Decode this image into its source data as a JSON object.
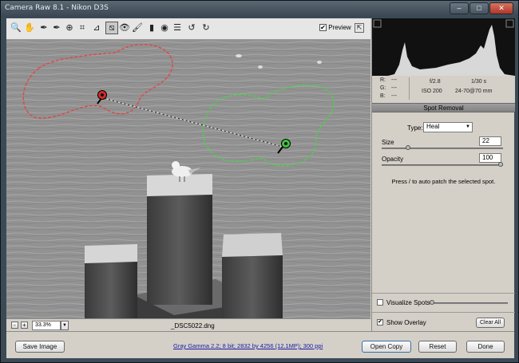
{
  "window": {
    "title": "Camera Raw 8.1  -  Nikon D3S"
  },
  "toolbar": {
    "tools": [
      {
        "name": "zoom-tool",
        "glyph": "🔍"
      },
      {
        "name": "hand-tool",
        "glyph": "✋"
      },
      {
        "name": "white-balance-tool",
        "glyph": "✒"
      },
      {
        "name": "color-sampler-tool",
        "glyph": "✒"
      },
      {
        "name": "targeted-adjustment-tool",
        "glyph": "⊕"
      },
      {
        "name": "crop-tool",
        "glyph": "⌗"
      },
      {
        "name": "straighten-tool",
        "glyph": "⊿"
      },
      {
        "name": "spot-removal-tool",
        "glyph": "⧅"
      },
      {
        "name": "red-eye-tool",
        "glyph": "👁"
      },
      {
        "name": "adjustment-brush-tool",
        "glyph": "🖌"
      },
      {
        "name": "graduated-filter-tool",
        "glyph": "▮"
      },
      {
        "name": "radial-filter-tool",
        "glyph": "◉"
      },
      {
        "name": "preferences-tool",
        "glyph": "☰"
      },
      {
        "name": "rotate-left-tool",
        "glyph": "↺"
      },
      {
        "name": "rotate-right-tool",
        "glyph": "↻"
      }
    ],
    "preview_label": "Preview",
    "preview_checked": true
  },
  "image_bar": {
    "zoom": "33.3%",
    "filename": "_DSC5022.dng"
  },
  "info": {
    "r_label": "R:",
    "g_label": "G:",
    "b_label": "B:",
    "r_value": "---",
    "g_value": "---",
    "b_value": "---",
    "aperture": "f/2.8",
    "shutter": "1/30 s",
    "iso": "ISO 200",
    "lens": "24-70@70 mm"
  },
  "panel": {
    "title": "Spot Removal",
    "type_label": "Type:",
    "type_value": "Heal",
    "size_label": "Size",
    "size_value": "22",
    "size_level": 0.22,
    "opacity_label": "Opacity",
    "opacity_value": "100",
    "opacity_level": 1.0,
    "hint": "Press / to auto patch the selected spot.",
    "visualize_label": "Visualize Spots",
    "visualize_checked": false,
    "show_overlay_label": "Show Overlay",
    "show_overlay_checked": true,
    "clear_all_label": "Clear All"
  },
  "bottom": {
    "save_label": "Save Image",
    "workflow_link": "Gray Gamma 2.2; 8 bit; 2832 by 4256 (12.1MP); 300 ppi",
    "open_label": "Open Copy",
    "reset_label": "Reset",
    "done_label": "Done"
  },
  "colors": {
    "source_spot": "#d62a2a",
    "target_spot": "#3cc43c"
  }
}
